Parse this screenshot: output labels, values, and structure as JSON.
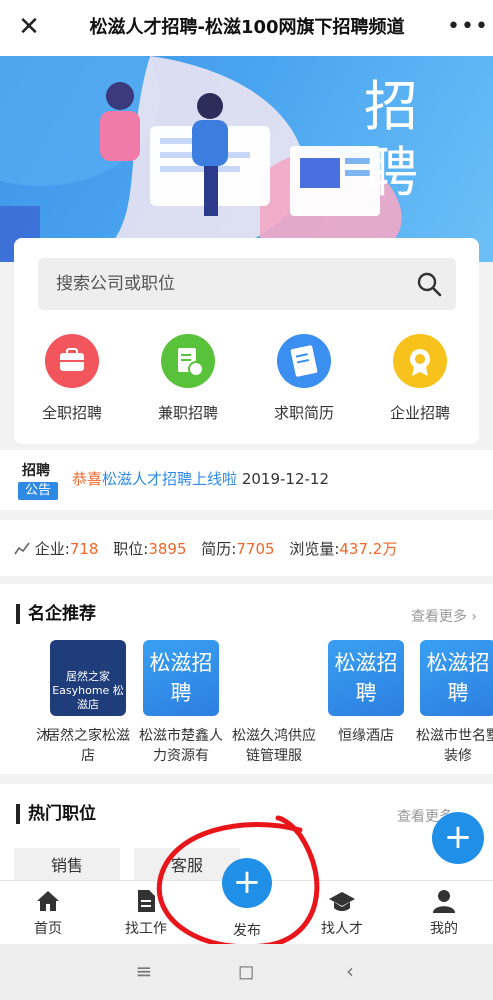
{
  "header": {
    "close_icon": "close-icon",
    "title": "松滋人才招聘-松滋100网旗下招聘频道",
    "more_icon": "more-icon"
  },
  "banner": {
    "text": "招聘"
  },
  "search": {
    "placeholder": "搜索公司或职位",
    "icon": "search-icon"
  },
  "categories": [
    {
      "label": "全职招聘",
      "icon": "briefcase-icon",
      "color": "#f2565c"
    },
    {
      "label": "兼职招聘",
      "icon": "document-clock-icon",
      "color": "#58c33a"
    },
    {
      "label": "求职简历",
      "icon": "resume-icon",
      "color": "#3b8ff0"
    },
    {
      "label": "企业招聘",
      "icon": "medal-icon",
      "color": "#f7c21b"
    }
  ],
  "notice": {
    "badge_top": "招聘",
    "badge_bottom": "公告",
    "prefix": "恭喜",
    "link": "松滋人才招聘上线啦",
    "date": "2019-12-12"
  },
  "stats": {
    "icon": "chart-icon",
    "items": [
      {
        "label": "企业:",
        "value": "718"
      },
      {
        "label": "职位:",
        "value": "3895"
      },
      {
        "label": "简历:",
        "value": "7705"
      },
      {
        "label": "浏览量:",
        "value": "437.2万"
      }
    ]
  },
  "featured": {
    "title": "名企推荐",
    "more": "查看更多",
    "companies": [
      {
        "name": "沐"
      },
      {
        "name": "居然之家松滋店",
        "logo_text": "居然之家 Easyhome 松滋店"
      },
      {
        "name": "松滋市楚鑫人力资源有",
        "logo_text": "松滋招聘"
      },
      {
        "name": "松滋久鸿供应链管理服"
      },
      {
        "name": "恒缘酒店",
        "logo_text": "松滋招聘"
      },
      {
        "name": "松滋市世名墅装修",
        "logo_text": "松滋招聘"
      }
    ]
  },
  "hot_jobs": {
    "title": "热门职位",
    "more": "查看更多",
    "tags": [
      "销售",
      "客服"
    ]
  },
  "tabbar": {
    "items": [
      {
        "label": "首页",
        "icon": "home-icon"
      },
      {
        "label": "找工作",
        "icon": "document-icon"
      },
      {
        "label": "发布",
        "icon": "plus-icon"
      },
      {
        "label": "找人才",
        "icon": "graduation-cap-icon"
      },
      {
        "label": "我的",
        "icon": "user-icon"
      }
    ]
  },
  "system_nav": {
    "menu": "≡",
    "home": "◻",
    "back": "‹"
  }
}
